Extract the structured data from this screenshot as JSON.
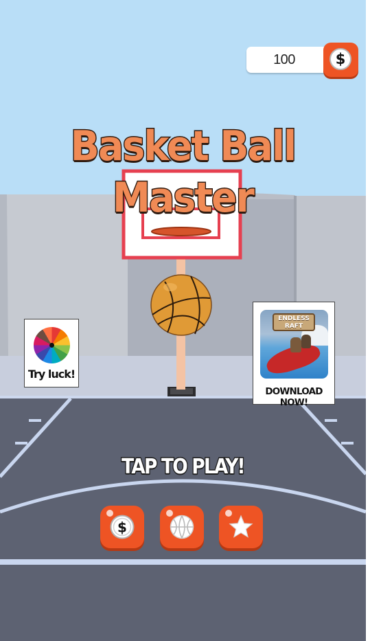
{
  "hud": {
    "coin_count": "100",
    "coin_icon": "dollar-coin-icon",
    "coin_symbol": "$"
  },
  "title": {
    "line1": "Basket Ball",
    "line2": "Master"
  },
  "side_left": {
    "label": "Try luck!",
    "icon": "color-wheel-icon"
  },
  "side_right": {
    "label": "DOWNLOAD NOW!",
    "ad_title_line1": "ENDLESS",
    "ad_title_line2": "RAFT"
  },
  "prompt": {
    "label": "TAP TO PLAY!"
  },
  "menu": [
    {
      "name": "coins",
      "icon": "dollar-coin-icon",
      "symbol": "$"
    },
    {
      "name": "balls",
      "icon": "basketball-icon"
    },
    {
      "name": "rating",
      "icon": "star-icon"
    }
  ],
  "colors": {
    "button_orange": "#ee5424",
    "sky": "#b9def7",
    "court": "#5d6272",
    "court_lines": "#c9d6ef",
    "title_orange": "#f08a55"
  }
}
